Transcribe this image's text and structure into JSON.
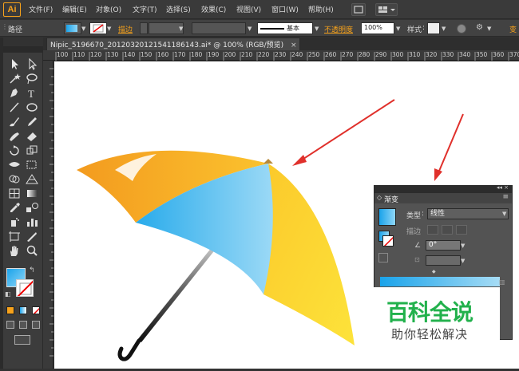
{
  "app": {
    "logo": "Ai"
  },
  "menu": [
    "文件(F)",
    "编辑(E)",
    "对象(O)",
    "文字(T)",
    "选择(S)",
    "效果(C)",
    "视图(V)",
    "窗口(W)",
    "帮助(H)"
  ],
  "control_bar": {
    "object_type": "路径",
    "stroke_label": "描边",
    "brush_label": "基本",
    "opacity_label": "不透明度",
    "opacity_value": "100%",
    "style_label": "样式",
    "right_cut": "变"
  },
  "document": {
    "tab_title": "Nipic_5196670_20120320121541186143.ai* @ 100% (RGB/预览)",
    "close_icon": "×"
  },
  "ruler": {
    "ticks": [
      "100",
      "110",
      "120",
      "130",
      "140",
      "150",
      "160",
      "170",
      "180",
      "190",
      "200",
      "210",
      "220",
      "230",
      "240",
      "250",
      "260",
      "270",
      "280",
      "290",
      "300",
      "310",
      "320",
      "330",
      "340",
      "350",
      "360",
      "370"
    ]
  },
  "gradient_panel": {
    "title": "渐变",
    "type_label": "类型",
    "type_value": "线性",
    "stroke_label": "描边",
    "angle_value": "0°"
  },
  "watermark": {
    "title": "百科全说",
    "subtitle": "助你轻松解决"
  },
  "colors": {
    "ai_orange": "#f7a21b",
    "umbrella_orange": "#f5a623",
    "umbrella_yellow": "#fcd52c",
    "umbrella_blue": "#43b7f0",
    "arrow_red": "#e0302b",
    "watermark_green": "#22b14c"
  }
}
